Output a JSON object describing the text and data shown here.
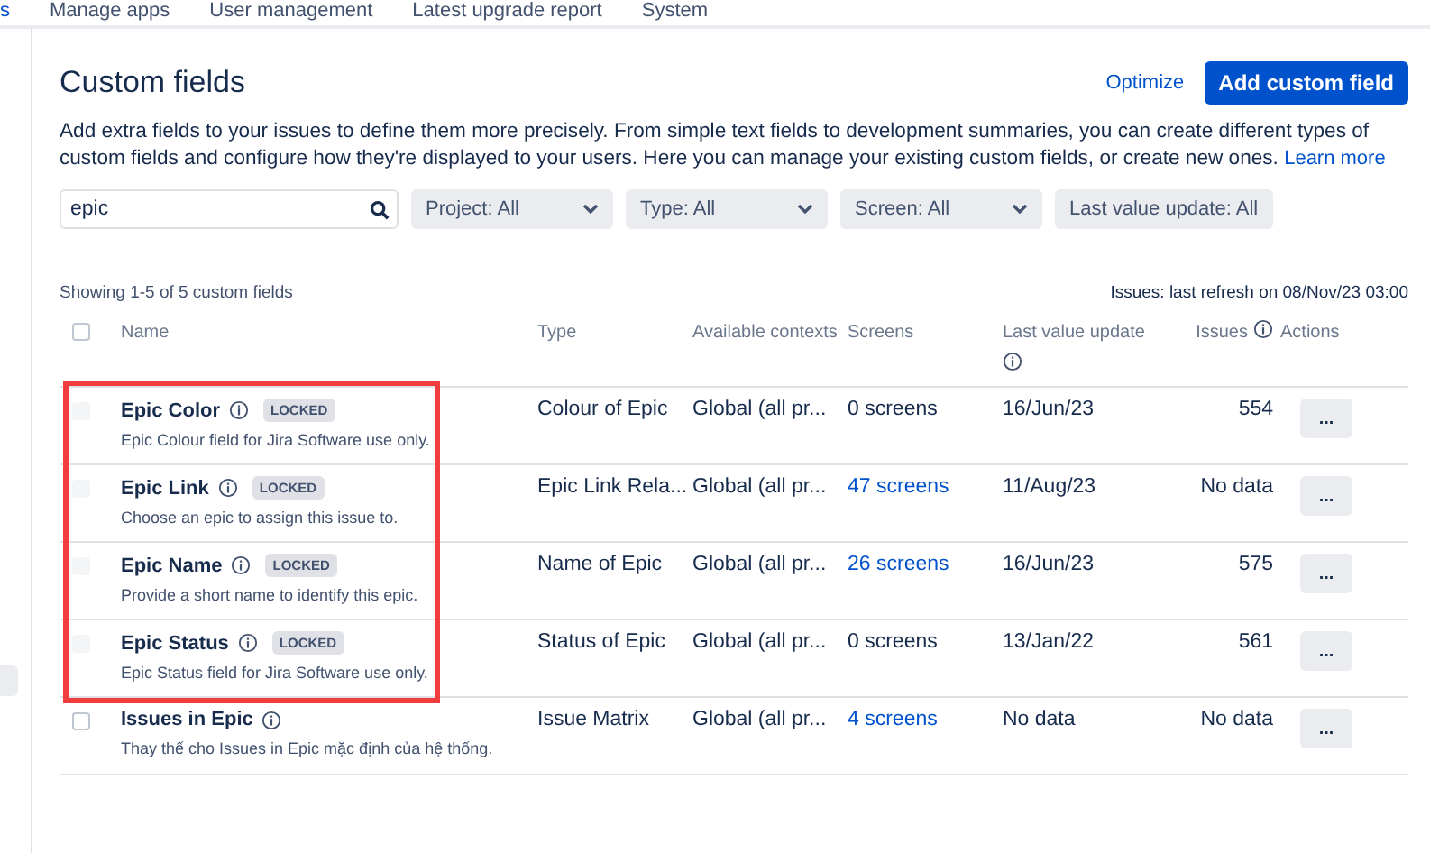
{
  "nav_tabs": [
    {
      "label": "s",
      "selected": true
    },
    {
      "label": "Manage apps",
      "selected": false
    },
    {
      "label": "User management",
      "selected": false
    },
    {
      "label": "Latest upgrade report",
      "selected": false
    },
    {
      "label": "System",
      "selected": false
    }
  ],
  "sidebar": {
    "items": [
      {
        "selected": true
      }
    ]
  },
  "page": {
    "title": "Custom fields",
    "optimize_link": "Optimize",
    "add_button": "Add custom field",
    "description": "Add extra fields to your issues to define them more precisely. From simple text fields to development summaries, you can create different types of custom fields and configure how they're displayed to your users. Here you can manage your existing custom fields, or create new ones.",
    "learn_more": "Learn more"
  },
  "search": {
    "value": "epic"
  },
  "filters": [
    {
      "label": "Project: All",
      "kind": "dropdown"
    },
    {
      "label": "Type: All",
      "kind": "dropdown"
    },
    {
      "label": "Screen: All",
      "kind": "dropdown"
    },
    {
      "label": "Last value update: All",
      "kind": "button"
    }
  ],
  "summary": "Showing 1-5 of 5 custom fields",
  "refresh_note": "Issues: last refresh on 08/Nov/23 03:00",
  "table": {
    "header_checkbox": {
      "checked": false
    },
    "columns": [
      {
        "label": "Name",
        "info": false
      },
      {
        "label": "Type",
        "info": false
      },
      {
        "label": "Available contexts",
        "info": false
      },
      {
        "label": "Screens",
        "info": false
      },
      {
        "label": "Last value update",
        "info": true
      },
      {
        "label": "Issues",
        "info": true
      },
      {
        "label": "Actions",
        "info": false
      }
    ],
    "rows": [
      {
        "name": "Epic Color",
        "badge": "LOCKED",
        "description": "Epic Colour field for Jira Software use only.",
        "type": "Colour of Epic",
        "contexts": "Global (all pr...",
        "screens": "0 screens",
        "screens_link": false,
        "last_update": "16/Jun/23",
        "issues": "554",
        "action": "...",
        "disabled": true,
        "highlighted": true
      },
      {
        "name": "Epic Link",
        "badge": "LOCKED",
        "description": "Choose an epic to assign this issue to.",
        "type": "Epic Link Rela...",
        "contexts": "Global (all pr...",
        "screens": "47 screens",
        "screens_link": true,
        "last_update": "11/Aug/23",
        "issues": "No data",
        "action": "...",
        "disabled": true,
        "highlighted": true
      },
      {
        "name": "Epic Name",
        "badge": "LOCKED",
        "description": "Provide a short name to identify this epic.",
        "type": "Name of Epic",
        "contexts": "Global (all pr...",
        "screens": "26 screens",
        "screens_link": true,
        "last_update": "16/Jun/23",
        "issues": "575",
        "action": "...",
        "disabled": true,
        "highlighted": true
      },
      {
        "name": "Epic Status",
        "badge": "LOCKED",
        "description": "Epic Status field for Jira Software use only.",
        "type": "Status of Epic",
        "contexts": "Global (all pr...",
        "screens": "0 screens",
        "screens_link": false,
        "last_update": "13/Jan/22",
        "issues": "561",
        "action": "...",
        "disabled": true,
        "highlighted": true
      },
      {
        "name": "Issues in Epic",
        "description": "Thay thế cho Issues in Epic mặc định của hệ thống.",
        "type": "Issue Matrix",
        "contexts": "Global (all pr...",
        "screens": "4 screens",
        "screens_link": true,
        "last_update": "No data",
        "issues": "No data",
        "action": "...",
        "disabled": false,
        "highlighted": false
      }
    ]
  }
}
